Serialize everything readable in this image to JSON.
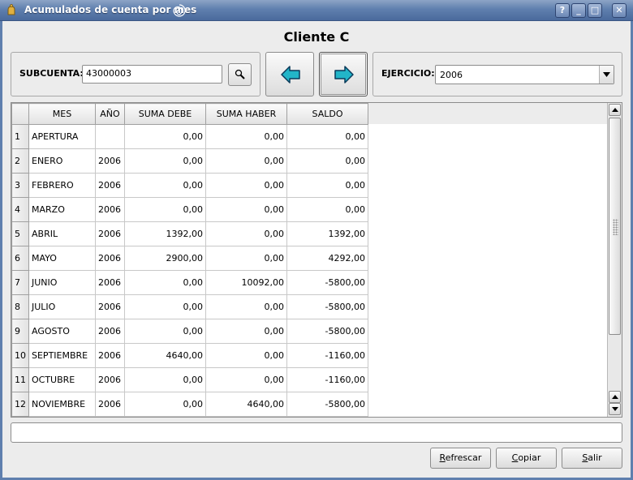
{
  "window": {
    "title": "Acumulados de cuenta por mes",
    "controls": [
      "?",
      "_",
      "□",
      "✕"
    ]
  },
  "heading": "Cliente C",
  "subcuenta": {
    "label": "SUBCUENTA:",
    "value": "43000003"
  },
  "ejercicio": {
    "label": "EJERCICIO:",
    "value": "2006"
  },
  "icons": {
    "search": "search-icon",
    "prev": "arrow-left-icon",
    "next": "arrow-right-icon"
  },
  "table": {
    "columns": [
      "MES",
      "AÑO",
      "SUMA DEBE",
      "SUMA HABER",
      "SALDO"
    ],
    "rows": [
      {
        "n": "1",
        "mes": "APERTURA",
        "anio": "",
        "debe": "0,00",
        "haber": "0,00",
        "saldo": "0,00"
      },
      {
        "n": "2",
        "mes": "ENERO",
        "anio": "2006",
        "debe": "0,00",
        "haber": "0,00",
        "saldo": "0,00"
      },
      {
        "n": "3",
        "mes": "FEBRERO",
        "anio": "2006",
        "debe": "0,00",
        "haber": "0,00",
        "saldo": "0,00"
      },
      {
        "n": "4",
        "mes": "MARZO",
        "anio": "2006",
        "debe": "0,00",
        "haber": "0,00",
        "saldo": "0,00"
      },
      {
        "n": "5",
        "mes": "ABRIL",
        "anio": "2006",
        "debe": "1392,00",
        "haber": "0,00",
        "saldo": "1392,00"
      },
      {
        "n": "6",
        "mes": "MAYO",
        "anio": "2006",
        "debe": "2900,00",
        "haber": "0,00",
        "saldo": "4292,00"
      },
      {
        "n": "7",
        "mes": "JUNIO",
        "anio": "2006",
        "debe": "0,00",
        "haber": "10092,00",
        "saldo": "-5800,00"
      },
      {
        "n": "8",
        "mes": "JULIO",
        "anio": "2006",
        "debe": "0,00",
        "haber": "0,00",
        "saldo": "-5800,00"
      },
      {
        "n": "9",
        "mes": "AGOSTO",
        "anio": "2006",
        "debe": "0,00",
        "haber": "0,00",
        "saldo": "-5800,00"
      },
      {
        "n": "10",
        "mes": "SEPTIEMBRE",
        "anio": "2006",
        "debe": "4640,00",
        "haber": "0,00",
        "saldo": "-1160,00"
      },
      {
        "n": "11",
        "mes": "OCTUBRE",
        "anio": "2006",
        "debe": "0,00",
        "haber": "0,00",
        "saldo": "-1160,00"
      },
      {
        "n": "12",
        "mes": "NOVIEMBRE",
        "anio": "2006",
        "debe": "0,00",
        "haber": "4640,00",
        "saldo": "-5800,00"
      }
    ]
  },
  "status_text": "",
  "buttons": {
    "refrescar": {
      "first": "R",
      "rest": "efrescar"
    },
    "copiar": {
      "first": "C",
      "rest": "opiar"
    },
    "salir": {
      "first": "S",
      "rest": "alir"
    }
  }
}
